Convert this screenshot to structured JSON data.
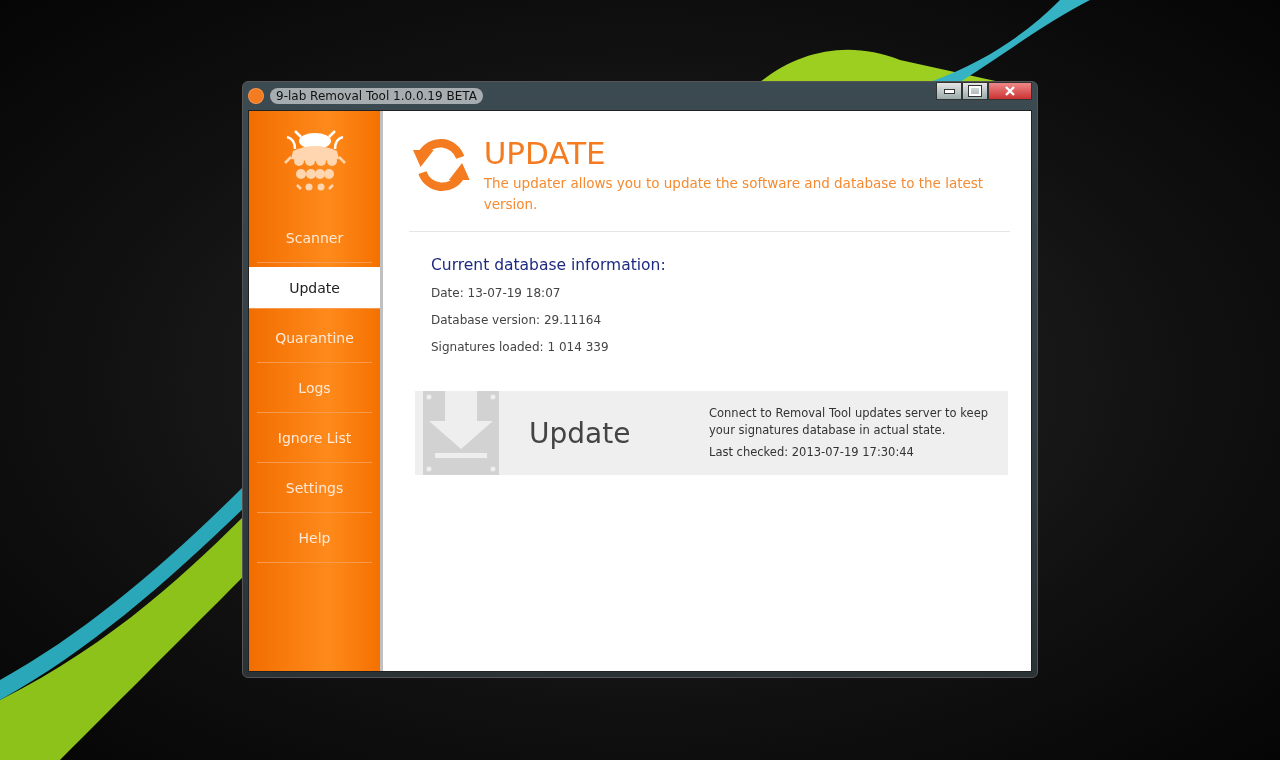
{
  "window": {
    "title": "9-lab Removal Tool 1.0.0.19 BETA"
  },
  "sidebar": {
    "items": [
      {
        "label": "Scanner",
        "selected": false
      },
      {
        "label": "Update",
        "selected": true
      },
      {
        "label": "Quarantine",
        "selected": false
      },
      {
        "label": "Logs",
        "selected": false
      },
      {
        "label": "Ignore List",
        "selected": false
      },
      {
        "label": "Settings",
        "selected": false
      },
      {
        "label": "Help",
        "selected": false
      }
    ]
  },
  "header": {
    "title": "UPDATE",
    "subtitle": "The updater allows you to update the software and database to the latest version."
  },
  "database_info": {
    "heading": "Current database information:",
    "lines": [
      "Date: 13-07-19 18:07",
      "Database version: 29.11164",
      "Signatures loaded: 1 014 339"
    ]
  },
  "update_panel": {
    "button_label": "Update",
    "description": "Connect to Removal Tool updates server to keep your signatures database in actual state.",
    "last_checked": "Last checked: 2013-07-19 17:30:44"
  }
}
